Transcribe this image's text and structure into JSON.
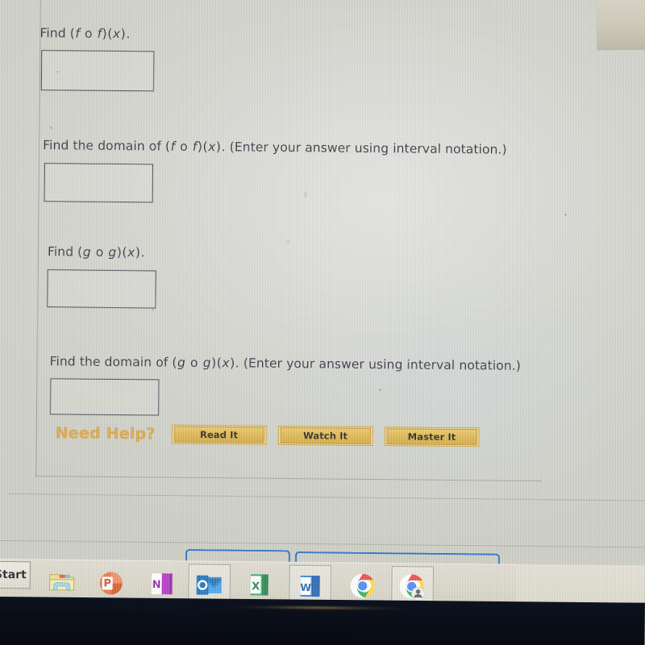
{
  "page": {
    "type": "online-homework-question",
    "background_color": "#d2d4cd",
    "text_color": "#2e2a38"
  },
  "questions": [
    {
      "id": "q1",
      "prompt_prefix": "Find",
      "expression": "(f o f)(x).",
      "full_text": "Find  (f o f)(x).",
      "answer_value": "",
      "answer_placeholder": ""
    },
    {
      "id": "q2",
      "prompt_prefix": "Find the domain of",
      "expression": "(f o f)(x).",
      "instruction": "(Enter your answer using interval notation.)",
      "full_text": "Find the domain of  (f o f)(x).  (Enter your answer using interval notation.)",
      "answer_value": "",
      "answer_placeholder": ""
    },
    {
      "id": "q3",
      "prompt_prefix": "Find",
      "expression": "(g o g)(x).",
      "full_text": "Find  (g o g)(x).",
      "answer_value": "",
      "answer_placeholder": ""
    },
    {
      "id": "q4",
      "prompt_prefix": "Find the domain of",
      "expression": "(g o g)(x).",
      "instruction": "(Enter your answer using interval notation.)",
      "full_text": "Find the domain of  (g o g)(x).  (Enter your answer using interval notation.)",
      "answer_value": "",
      "answer_placeholder": ""
    }
  ],
  "help": {
    "label": "Need Help?",
    "label_color": "#d9a13a",
    "button_color": "#dcb346",
    "buttons": [
      {
        "label": "Read It"
      },
      {
        "label": "Watch It"
      },
      {
        "label": "Master It"
      }
    ]
  },
  "taskbar": {
    "start_label": "Start",
    "accent_color": "#1a63c4",
    "items": [
      {
        "icon": "file-explorer-icon",
        "name": "file-explorer",
        "active": false
      },
      {
        "icon": "powerpoint-icon",
        "name": "powerpoint",
        "active": false,
        "letter": "P"
      },
      {
        "icon": "onenote-icon",
        "name": "onenote",
        "active": false,
        "letter": "N"
      },
      {
        "icon": "outlook-icon",
        "name": "outlook",
        "active": true,
        "letter": "O"
      },
      {
        "icon": "excel-icon",
        "name": "excel",
        "active": false,
        "letter": "X"
      },
      {
        "icon": "word-icon",
        "name": "word",
        "active": true,
        "letter": "W"
      },
      {
        "icon": "chrome-icon",
        "name": "chrome",
        "active": false
      },
      {
        "icon": "chrome-profile-icon",
        "name": "chrome-profile",
        "active": true
      }
    ]
  }
}
